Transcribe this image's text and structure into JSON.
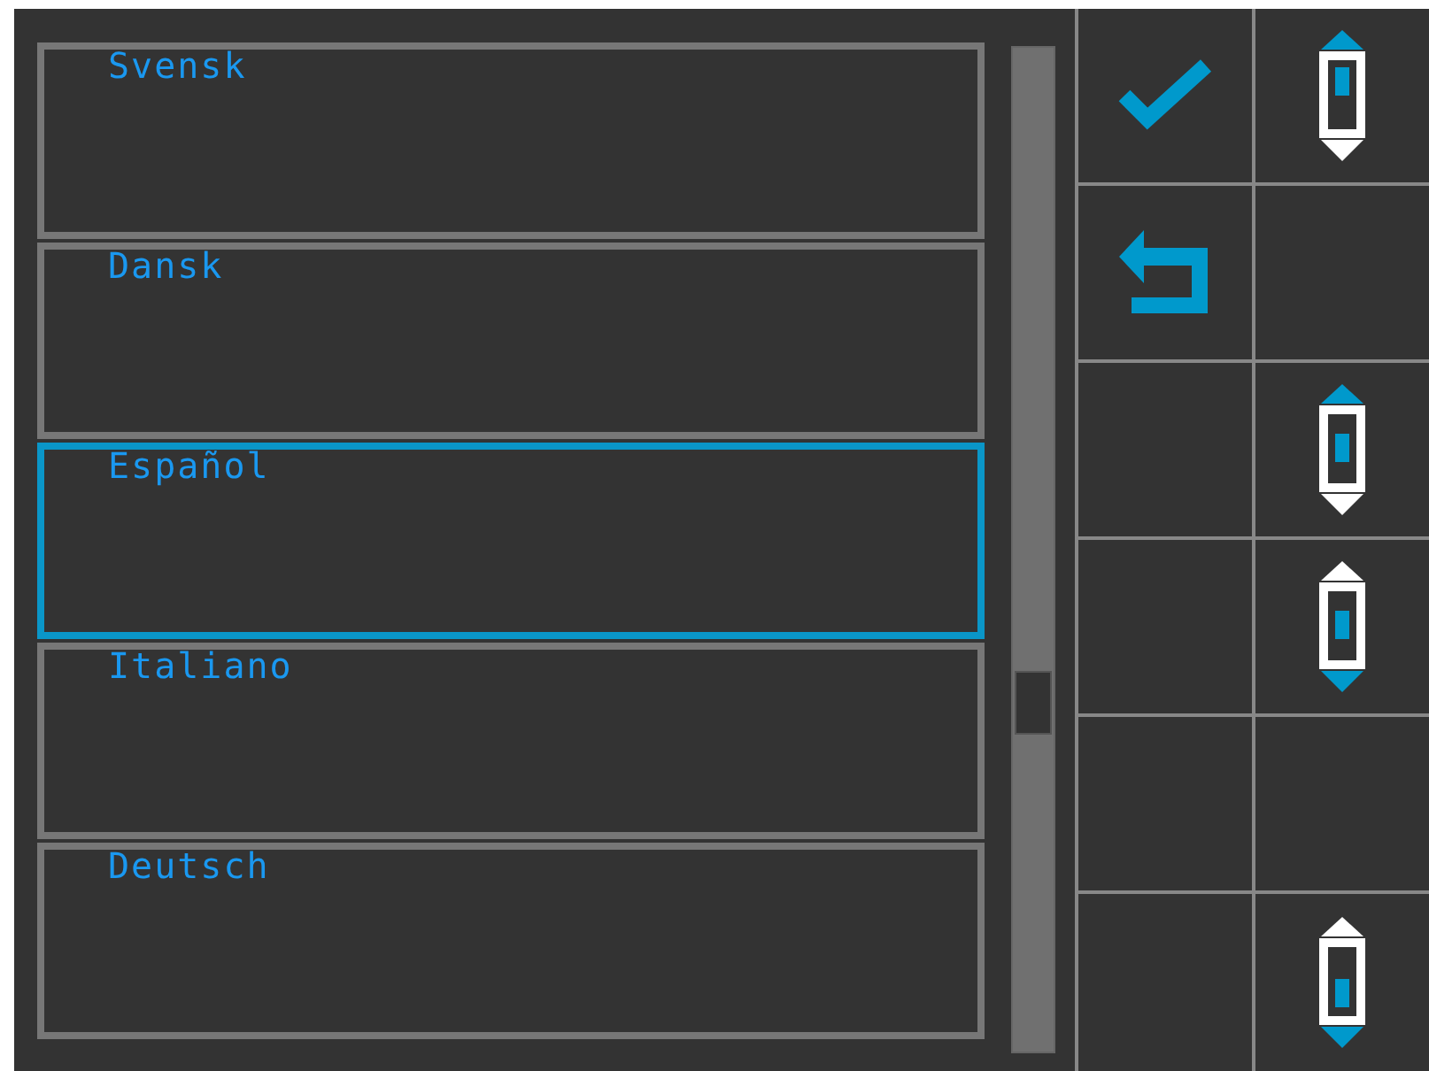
{
  "languages": [
    {
      "label": "Svensk",
      "selected": false
    },
    {
      "label": "Dansk",
      "selected": false
    },
    {
      "label": "Español",
      "selected": true
    },
    {
      "label": "Italiano",
      "selected": false
    },
    {
      "label": "Deutsch",
      "selected": false
    }
  ],
  "buttons": [
    {
      "kind": "confirm"
    },
    {
      "kind": "page-up"
    },
    {
      "kind": "back"
    },
    {
      "kind": "blank"
    },
    {
      "kind": "blank"
    },
    {
      "kind": "line-up"
    },
    {
      "kind": "blank"
    },
    {
      "kind": "line-down"
    },
    {
      "kind": "blank"
    },
    {
      "kind": "blank"
    },
    {
      "kind": "blank"
    },
    {
      "kind": "page-down"
    }
  ]
}
